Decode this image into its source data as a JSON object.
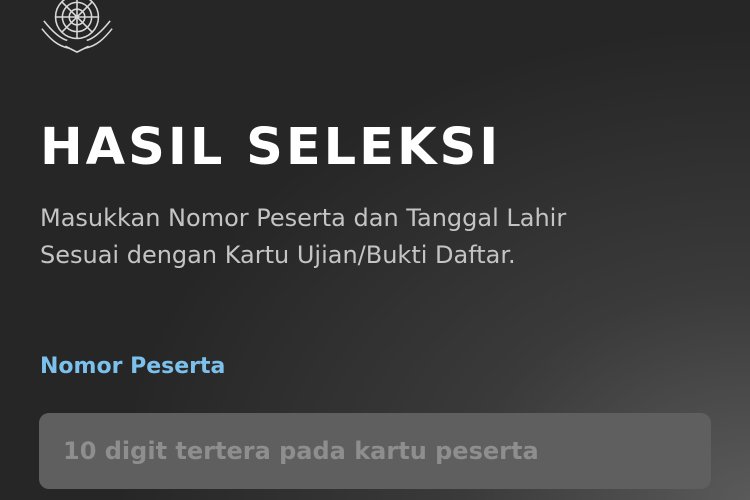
{
  "header": {
    "logo_icon": "university-emblem-icon"
  },
  "page": {
    "title": "HASIL SELEKSI",
    "subtitle_line1": "Masukkan Nomor Peserta dan Tanggal Lahir",
    "subtitle_line2": "Sesuai dengan Kartu Ujian/Bukti Daftar."
  },
  "form": {
    "nomor_peserta": {
      "label": "Nomor Peserta",
      "value": "",
      "placeholder": "10 digit tertera pada kartu peserta"
    }
  },
  "colors": {
    "label_accent": "#7cc0ec",
    "input_bg": "#5f5f5f"
  }
}
